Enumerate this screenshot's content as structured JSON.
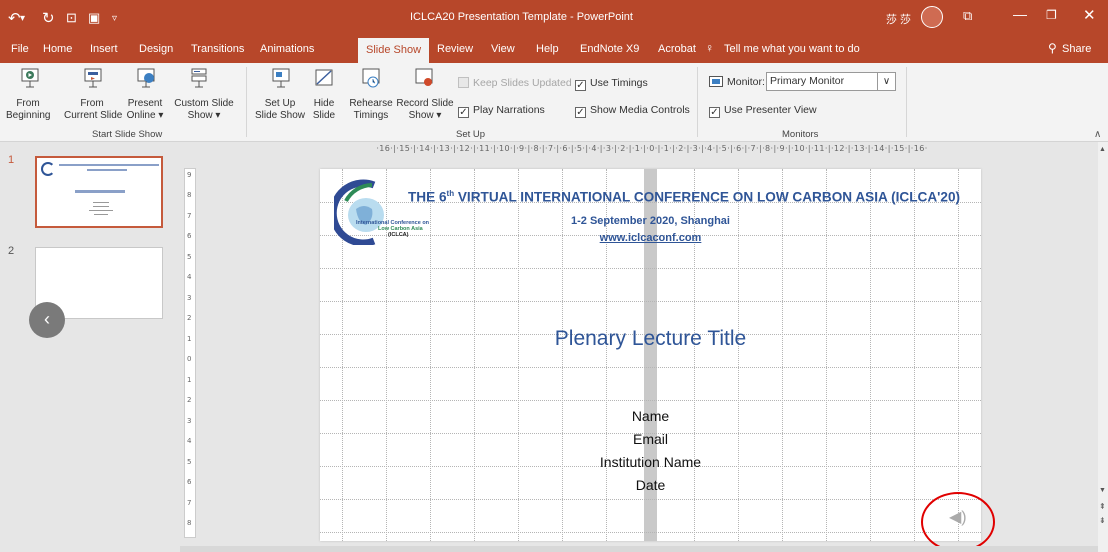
{
  "window": {
    "title": "ICLCA20 Presentation Template - PowerPoint",
    "user_initials": "莎 莎"
  },
  "tabs": [
    "File",
    "Home",
    "Insert",
    "Design",
    "Transitions",
    "Animations",
    "Slide Show",
    "Review",
    "View",
    "Help",
    "EndNote X9",
    "Acrobat"
  ],
  "active_tab": "Slide Show",
  "tell_me": "Tell me what you want to do",
  "share": "Share",
  "ribbon": {
    "start_group": "Start Slide Show",
    "setup_group": "Set Up",
    "monitors_group": "Monitors",
    "from_beginning": [
      "From",
      "Beginning"
    ],
    "from_current": [
      "From",
      "Current Slide"
    ],
    "present_online": [
      "Present",
      "Online ▾"
    ],
    "custom_show": [
      "Custom Slide",
      "Show ▾"
    ],
    "setup_show": [
      "Set Up",
      "Slide Show"
    ],
    "hide_slide": [
      "Hide",
      "Slide"
    ],
    "rehearse": [
      "Rehearse",
      "Timings"
    ],
    "record": [
      "Record Slide",
      "Show ▾"
    ],
    "keep_updated": "Keep Slides Updated",
    "use_timings": "Use Timings",
    "play_narrations": "Play Narrations",
    "media_controls": "Show Media Controls",
    "monitor_label": "Monitor:",
    "monitor_value": "Primary Monitor",
    "presenter_view": "Use Presenter View"
  },
  "ruler_text": "·16·|·15·|·14·|·13·|·12·|·11·|·10·|·9·|·8·|·7·|·6·|·5·|·4·|·3·|·2·|·1·|·0·|·1·|·2·|·3·|·4·|·5·|·6·|·7·|·8·|·9·|·10·|·11·|·12·|·13·|·14·|·15·|·16·",
  "slides": [
    {
      "number": "1"
    },
    {
      "number": "2"
    }
  ],
  "slide": {
    "conf_title_pre": "THE 6",
    "conf_title_sup": "th",
    "conf_title_post": " VIRTUAL INTERNATIONAL CONFERENCE ON LOW CARBON ASIA (ICLCA'20)",
    "date_place": "1-2 September 2020, Shanghai",
    "url": "www.iclcaconf.com",
    "logo_lines": [
      "International Conference on",
      "Low Carbon Asia",
      "(ICLCA)"
    ],
    "lecture_title": "Plenary Lecture Title",
    "name": "Name",
    "email": "Email",
    "institution": "Institution Name",
    "date": "Date"
  },
  "colors": {
    "accent": "#b7472a",
    "title_blue": "#2f5597",
    "highlight": "#e00000"
  }
}
